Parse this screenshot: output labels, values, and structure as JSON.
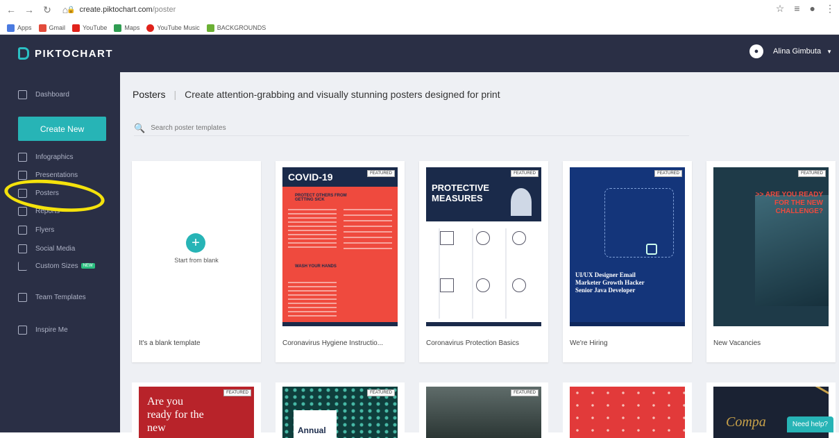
{
  "browser": {
    "url_host": "create.piktochart.com",
    "url_path": "/poster",
    "bookmarks": [
      "Apps",
      "Gmail",
      "YouTube",
      "Maps",
      "YouTube Music",
      "BACKGROUNDS"
    ]
  },
  "header": {
    "logo": "PIKTOCHART",
    "user_name": "Alina Gimbuta"
  },
  "sidebar": {
    "dashboard": "Dashboard",
    "create_new": "Create New",
    "items": [
      "Infographics",
      "Presentations",
      "Posters",
      "Reports",
      "Flyers",
      "Social Media",
      "Custom Sizes"
    ],
    "new_badge": "NEW",
    "team_templates": "Team Templates",
    "inspire_me": "Inspire Me"
  },
  "main": {
    "title": "Posters",
    "subtitle": "Create attention-grabbing and visually stunning posters designed for print",
    "search_placeholder": "Search poster templates",
    "blank_text": "Start from blank",
    "featured": "FEATURED",
    "cards": [
      "It's a blank template",
      "Coronavirus Hygiene Instructio...",
      "Coronavirus Protection Basics",
      "We're Hiring",
      "New Vacancies"
    ],
    "poster_text": {
      "covid": "COVID-19",
      "protect": "PROTECT OTHERS FROM GETTING SICK",
      "wash": "WASH YOUR HANDS",
      "protective": "PROTECTIVE MEASURES",
      "hiring_lines": "UI/UX Designer Email Marketer Growth Hacker Senior Java Developer",
      "challenge": ">> ARE YOU READY FOR THE NEW CHALLENGE?",
      "are_you": "Are you ready for the new",
      "annual": "Annual",
      "compa": "Compa"
    },
    "help": "Need help?"
  }
}
